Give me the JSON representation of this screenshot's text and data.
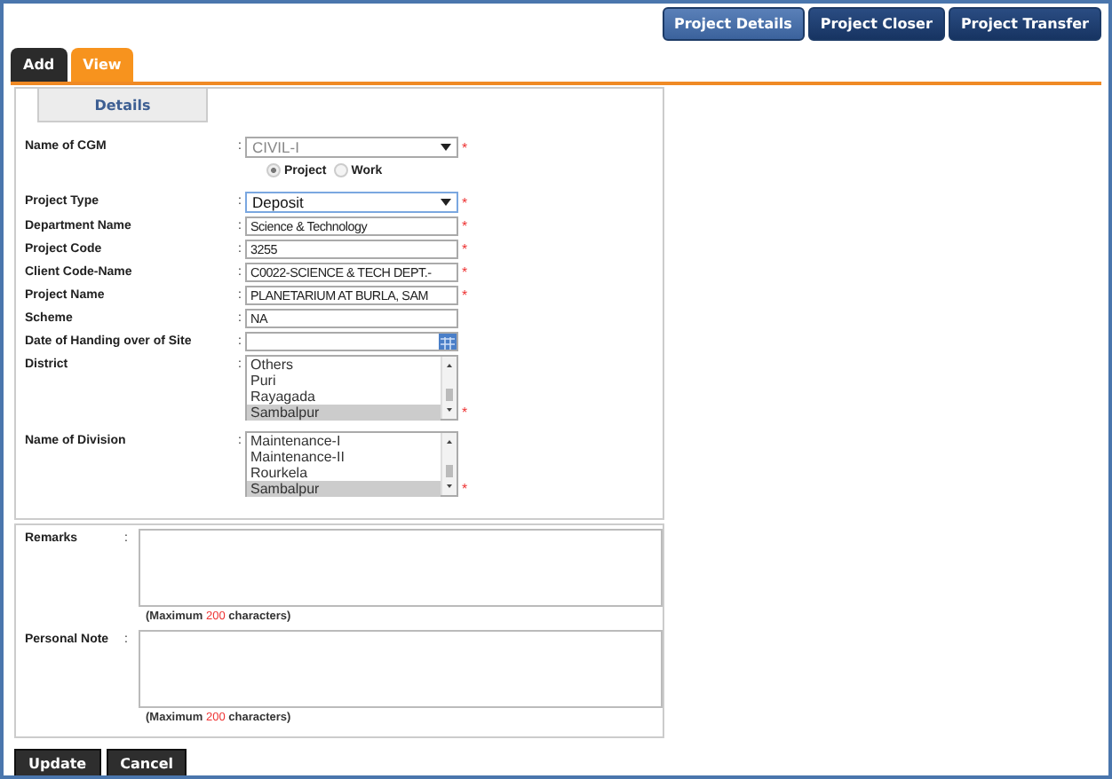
{
  "top_buttons": [
    {
      "label": "Project Details",
      "selected": true
    },
    {
      "label": "Project Closer",
      "selected": false
    },
    {
      "label": "Project Transfer",
      "selected": false
    }
  ],
  "tabs": [
    {
      "label": "Add",
      "selected": false
    },
    {
      "label": "View",
      "selected": true
    }
  ],
  "section_tab": "Details",
  "fields": [
    {
      "kind": "select",
      "label": "Name of CGM",
      "colon": ":",
      "value": "CIVIL-I",
      "disabled": true,
      "marker": "*"
    },
    {
      "kind": "radio",
      "options": [
        {
          "label": "Project",
          "selected": true
        },
        {
          "label": "Work",
          "selected": false
        }
      ]
    },
    {
      "kind": "select",
      "label": "Project Type",
      "colon": ":",
      "value": "Deposit",
      "disabled": false,
      "marker": "*"
    },
    {
      "kind": "text",
      "label": "Department Name",
      "colon": ":",
      "value": "Science & Technology",
      "marker": "*"
    },
    {
      "kind": "text",
      "label": "Project Code",
      "colon": ":",
      "value": "3255",
      "marker": "*"
    },
    {
      "kind": "text",
      "label": "Client Code-Name",
      "colon": ":",
      "value": "C0022-SCIENCE & TECH DEPT.-",
      "marker": "*"
    },
    {
      "kind": "text",
      "label": "Project Name",
      "colon": ":",
      "value": "PLANETARIUM AT BURLA, SAM",
      "marker": "*"
    },
    {
      "kind": "text",
      "label": "Scheme",
      "colon": ":",
      "value": "NA"
    },
    {
      "kind": "date",
      "label": "Date of Handing over of Site",
      "colon": ":"
    },
    {
      "kind": "list",
      "label": "District",
      "colon": ":",
      "marker": "*",
      "items": [
        {
          "label": "Others",
          "selected": false
        },
        {
          "label": "Puri",
          "selected": false
        },
        {
          "label": "Rayagada",
          "selected": false
        },
        {
          "label": "Sambalpur",
          "selected": true
        }
      ]
    },
    {
      "kind": "list",
      "label": "Name of Division",
      "colon": ":",
      "marker": "*",
      "items": [
        {
          "label": "Maintenance-I",
          "selected": false
        },
        {
          "label": "Maintenance-II",
          "selected": false
        },
        {
          "label": "Rourkela",
          "selected": false
        },
        {
          "label": "Sambalpur",
          "selected": true
        }
      ]
    }
  ],
  "notes": [
    {
      "label": "Remarks",
      "colon": ":",
      "hint_before": "(Maximum",
      "limit": "200",
      "hint_after": "characters)"
    },
    {
      "label": "Personal Note",
      "colon": ":",
      "hint_before": "(Maximum",
      "limit": "200",
      "hint_after": "characters)"
    }
  ],
  "actions": [
    "Update",
    "Cancel"
  ]
}
